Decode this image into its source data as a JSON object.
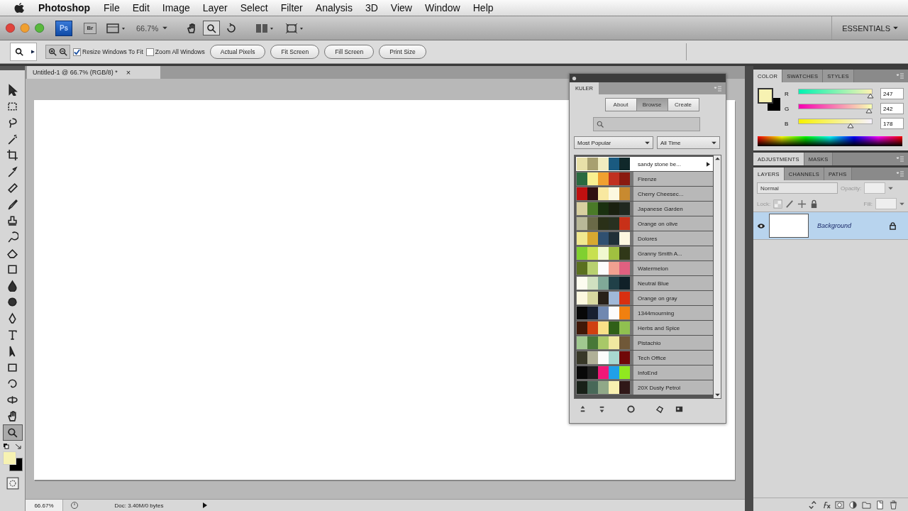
{
  "menu_bar": {
    "app_name": "Photoshop",
    "items": [
      "File",
      "Edit",
      "Image",
      "Layer",
      "Select",
      "Filter",
      "Analysis",
      "3D",
      "View",
      "Window",
      "Help"
    ]
  },
  "app_bar": {
    "logo": "Ps",
    "bridge": "Br",
    "zoom": "66.7%",
    "tools": [
      {
        "kind": "hand",
        "selected": false
      },
      {
        "kind": "zoom",
        "selected": true
      },
      {
        "kind": "rotate",
        "selected": false
      }
    ],
    "workspace": "ESSENTIALS"
  },
  "options_bar": {
    "checkboxes": [
      {
        "label": "Resize Windows To Fit",
        "checked": true
      },
      {
        "label": "Zoom All Windows",
        "checked": false
      }
    ],
    "buttons": [
      "Actual Pixels",
      "Fit Screen",
      "Fill Screen",
      "Print Size"
    ]
  },
  "toolbox": {
    "tools": [
      {
        "kind": "move",
        "selected": false
      },
      {
        "kind": "marquee",
        "selected": false
      },
      {
        "kind": "lasso",
        "selected": false
      },
      {
        "kind": "wand",
        "selected": false
      },
      {
        "kind": "crop",
        "selected": false
      },
      {
        "kind": "eyedropper",
        "selected": false
      },
      {
        "kind": "healing",
        "selected": false
      },
      {
        "kind": "brush",
        "selected": false
      },
      {
        "kind": "stamp",
        "selected": false
      },
      {
        "kind": "history",
        "selected": false
      },
      {
        "kind": "eraser",
        "selected": false
      },
      {
        "kind": "gradient",
        "selected": false
      },
      {
        "kind": "blur",
        "selected": false
      },
      {
        "kind": "dodge",
        "selected": false
      },
      {
        "kind": "pen",
        "selected": false
      },
      {
        "kind": "type",
        "selected": false
      },
      {
        "kind": "path",
        "selected": false
      },
      {
        "kind": "shape",
        "selected": false
      },
      {
        "kind": "rotate3d",
        "selected": false
      },
      {
        "kind": "orbit3d",
        "selected": false
      },
      {
        "kind": "hand",
        "selected": false
      },
      {
        "kind": "zoom",
        "selected": true
      }
    ]
  },
  "document": {
    "tab": "Untitled-1 @ 66.7% (RGB/8) *",
    "close": "×",
    "status": {
      "zoom": "66.67%",
      "info": "Doc: 3.40M/0 bytes"
    }
  },
  "kuler": {
    "title": "KULER",
    "tabs": [
      {
        "label": "About",
        "selected": false
      },
      {
        "label": "Browse",
        "selected": true
      },
      {
        "label": "Create",
        "selected": false
      }
    ],
    "filters": [
      "Most Popular",
      "All Time"
    ],
    "themes": [
      {
        "name": "sandy stone be...",
        "selected": true,
        "swatches": [
          {
            "color": "#e8e0a8"
          },
          {
            "color": "#a8a070"
          },
          {
            "color": "#f0ecc0"
          },
          {
            "color": "#1a5a80"
          },
          {
            "color": "#10282a"
          }
        ]
      },
      {
        "name": "Firenze",
        "selected": false,
        "swatches": [
          {
            "color": "#2a6a40"
          },
          {
            "color": "#f8f090"
          },
          {
            "color": "#f0a030"
          },
          {
            "color": "#c03020"
          },
          {
            "color": "#8a1a10"
          }
        ]
      },
      {
        "name": "Cherry Cheesec...",
        "selected": false,
        "swatches": [
          {
            "color": "#c01010"
          },
          {
            "color": "#301010"
          },
          {
            "color": "#f8e8a0"
          },
          {
            "color": "#fcf8e0"
          },
          {
            "color": "#c88a30"
          }
        ]
      },
      {
        "name": "Japanese Garden",
        "selected": false,
        "swatches": [
          {
            "color": "#d8d0a0"
          },
          {
            "color": "#4a7a28"
          },
          {
            "color": "#1a3010"
          },
          {
            "color": "#1a2010"
          },
          {
            "color": "#202820"
          }
        ]
      },
      {
        "name": "Orange on olive",
        "selected": false,
        "swatches": [
          {
            "color": "#b8b898"
          },
          {
            "color": "#6a6a48"
          },
          {
            "color": "#2a3018"
          },
          {
            "color": "#283020"
          },
          {
            "color": "#c83018"
          }
        ]
      },
      {
        "name": "Dolores",
        "selected": false,
        "swatches": [
          {
            "color": "#f0e890"
          },
          {
            "color": "#d8a830"
          },
          {
            "color": "#305070"
          },
          {
            "color": "#203038"
          },
          {
            "color": "#fcf8e0"
          }
        ]
      },
      {
        "name": "Granny Smith A...",
        "selected": false,
        "swatches": [
          {
            "color": "#80d030"
          },
          {
            "color": "#c8e050"
          },
          {
            "color": "#f0f8d0"
          },
          {
            "color": "#a0c040"
          },
          {
            "color": "#303818"
          }
        ]
      },
      {
        "name": "Watermelon",
        "selected": false,
        "swatches": [
          {
            "color": "#5a7020"
          },
          {
            "color": "#b8d070"
          },
          {
            "color": "#fcfcfc"
          },
          {
            "color": "#f0a090"
          },
          {
            "color": "#e06080"
          }
        ]
      },
      {
        "name": "Neutral Blue",
        "selected": false,
        "swatches": [
          {
            "color": "#fcfcf0"
          },
          {
            "color": "#d0e0c0"
          },
          {
            "color": "#80a898"
          },
          {
            "color": "#204048"
          },
          {
            "color": "#102028"
          }
        ]
      },
      {
        "name": "Orange on gray",
        "selected": false,
        "swatches": [
          {
            "color": "#fcf8e0"
          },
          {
            "color": "#d8d8a0"
          },
          {
            "color": "#282018"
          },
          {
            "color": "#a0b8d8"
          },
          {
            "color": "#d83010"
          }
        ]
      },
      {
        "name": "1344mourning",
        "selected": false,
        "swatches": [
          {
            "color": "#080808"
          },
          {
            "color": "#182030"
          },
          {
            "color": "#7088b0"
          },
          {
            "color": "#fcfcfc"
          },
          {
            "color": "#f08010"
          }
        ]
      },
      {
        "name": "Herbs and Spice",
        "selected": false,
        "swatches": [
          {
            "color": "#401808"
          },
          {
            "color": "#d04010"
          },
          {
            "color": "#f8e088"
          },
          {
            "color": "#306018"
          },
          {
            "color": "#90c050"
          }
        ]
      },
      {
        "name": "Pistachio",
        "selected": false,
        "swatches": [
          {
            "color": "#a0c890"
          },
          {
            "color": "#487838"
          },
          {
            "color": "#a8c868"
          },
          {
            "color": "#f0e8a0"
          },
          {
            "color": "#705838"
          }
        ]
      },
      {
        "name": "Tech Office",
        "selected": false,
        "swatches": [
          {
            "color": "#383828"
          },
          {
            "color": "#b0b098"
          },
          {
            "color": "#fcfcfc"
          },
          {
            "color": "#a8d8d0"
          },
          {
            "color": "#700808"
          }
        ]
      },
      {
        "name": "InfoEnd",
        "selected": false,
        "swatches": [
          {
            "color": "#080808"
          },
          {
            "color": "#202020"
          },
          {
            "color": "#f01878"
          },
          {
            "color": "#20a0e8"
          },
          {
            "color": "#90e820"
          }
        ]
      },
      {
        "name": "20X Dusty Petrol",
        "selected": false,
        "swatches": [
          {
            "color": "#182018"
          },
          {
            "color": "#486858"
          },
          {
            "color": "#90a888"
          },
          {
            "color": "#f8f0b0"
          },
          {
            "color": "#301818"
          }
        ]
      }
    ]
  },
  "color_panel": {
    "tabs": [
      {
        "label": "COLOR",
        "selected": true
      },
      {
        "label": "SWATCHES",
        "selected": false
      },
      {
        "label": "STYLES",
        "selected": false
      }
    ],
    "channels": [
      {
        "name": "R",
        "value": "247",
        "level": 0.97
      },
      {
        "name": "G",
        "value": "242",
        "level": 0.95
      },
      {
        "name": "B",
        "value": "178",
        "level": 0.7
      }
    ]
  },
  "adjustments_panel": {
    "tabs": [
      {
        "label": "ADJUSTMENTS",
        "selected": true
      },
      {
        "label": "MASKS",
        "selected": false
      }
    ]
  },
  "layers_panel": {
    "tabs": [
      {
        "label": "LAYERS",
        "selected": true
      },
      {
        "label": "CHANNELS",
        "selected": false
      },
      {
        "label": "PATHS",
        "selected": false
      }
    ],
    "blend_mode": "Normal",
    "opacity_label": "Opacity:",
    "lock_label": "Lock:",
    "fill_label": "Fill:",
    "layers": [
      {
        "name": "Background",
        "selected": true,
        "visible": true
      }
    ]
  }
}
